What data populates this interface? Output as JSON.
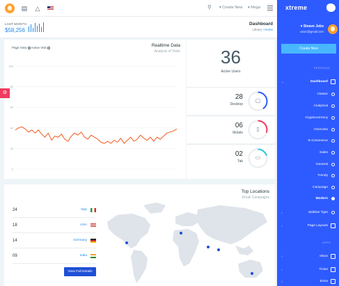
{
  "topbar": {
    "create_new": "Create New",
    "mega": "Mega",
    "icons": [
      "logo-icon",
      "message-icon",
      "bell-icon",
      "us-flag-icon",
      "search-icon",
      "menu-icon"
    ]
  },
  "page_header": {
    "last_month_label": "LAST MONTH",
    "last_month_value": "$58,256",
    "title": "Dashboard",
    "breadcrumb_library": "Library",
    "breadcrumb_separator": "/",
    "breadcrumb_home": "Home"
  },
  "realtime": {
    "title": "Realtime Data",
    "subtitle": "Analysis of Visits",
    "legend_page_view": "Page View",
    "legend_active_visit": "Active Visit"
  },
  "chart_data": {
    "type": "line",
    "title": "Realtime Data",
    "subtitle": "Analysis of Visits",
    "ylim": [
      0,
      100
    ],
    "y_ticks": [
      0,
      20,
      40,
      60,
      80,
      100
    ],
    "grid": true,
    "legend": "top-left",
    "series": [
      {
        "name": "Page View",
        "color": "#f2591c",
        "values": [
          38,
          40,
          41,
          39,
          36,
          38,
          35,
          38,
          34,
          31,
          35,
          28,
          32,
          31,
          34,
          29,
          27,
          32,
          35,
          33,
          36,
          31,
          29,
          33,
          31,
          29,
          26,
          25,
          27,
          25,
          28,
          26,
          30,
          25,
          28,
          31,
          27,
          29,
          33,
          30,
          28,
          31,
          27,
          31,
          29,
          32,
          35,
          36,
          37,
          39
        ]
      }
    ]
  },
  "active_users": {
    "value": "36",
    "label": "Active Users"
  },
  "devices": [
    {
      "value": "28",
      "label": "Desktop",
      "icon": "monitor-icon",
      "percent": 40,
      "color": "#2e5bff"
    },
    {
      "value": "06",
      "label": "Mobile",
      "icon": "mobile-icon",
      "percent": 30,
      "color": "#f03a5f"
    },
    {
      "value": "02",
      "label": "Tab",
      "icon": "tablet-icon",
      "percent": 20,
      "color": "#26c6da"
    }
  ],
  "locations": {
    "title": "Top Locations",
    "subtitle": "Email Campaigns",
    "rows": [
      {
        "value": "24",
        "country": "Italy"
      },
      {
        "value": "18",
        "country": "USA"
      },
      {
        "value": "14",
        "country": "Germany"
      },
      {
        "value": "09",
        "country": "India"
      }
    ],
    "button": "View Full Details"
  },
  "sidebar": {
    "brand": "xtreme",
    "user_name": "Steave Jobs",
    "user_email": "varun@gmail.com",
    "create_new": "Create New",
    "section_personal": "PERSONAL",
    "section_apps": "APPS",
    "items": [
      {
        "label": "Dashboard",
        "main": true
      },
      {
        "label": "Classic"
      },
      {
        "label": "Analytical"
      },
      {
        "label": "Cryptocurrency"
      },
      {
        "label": "Overview"
      },
      {
        "label": "E-Commerce"
      },
      {
        "label": "Sales"
      },
      {
        "label": "General"
      },
      {
        "label": "Trendy"
      },
      {
        "label": "Campaign"
      },
      {
        "label": "Modern",
        "main": true
      },
      {
        "label": "Sidebar Type"
      },
      {
        "label": "Page Layouts"
      },
      {
        "label": "Inbox"
      },
      {
        "label": "Ticket"
      },
      {
        "label": "Extra"
      }
    ]
  }
}
